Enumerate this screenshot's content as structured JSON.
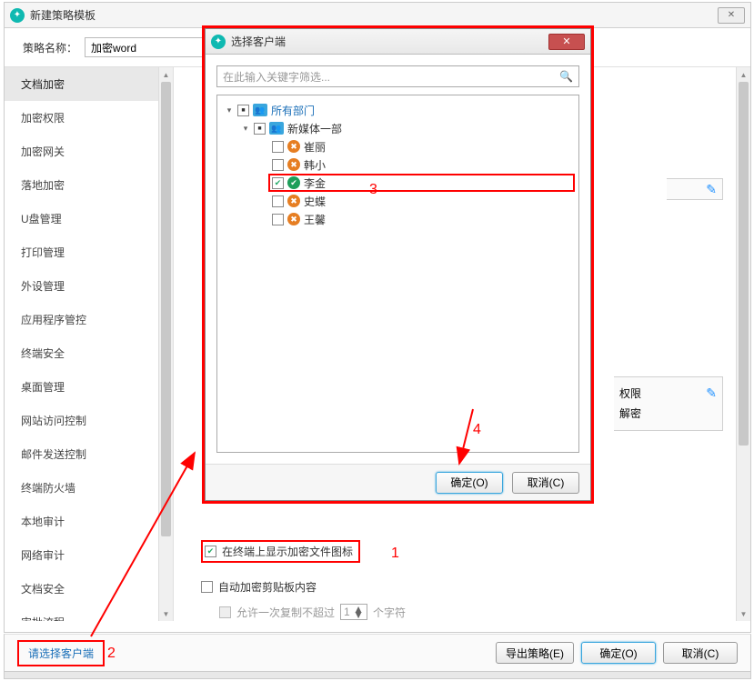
{
  "main": {
    "title": "新建策略模板",
    "name_label": "策略名称：",
    "name_value": "加密word"
  },
  "sidebar": {
    "items": [
      {
        "label": "文档加密",
        "active": true
      },
      {
        "label": "加密权限"
      },
      {
        "label": "加密网关"
      },
      {
        "label": "落地加密"
      },
      {
        "label": "U盘管理"
      },
      {
        "label": "打印管理"
      },
      {
        "label": "外设管理"
      },
      {
        "label": "应用程序管控"
      },
      {
        "label": "终端安全"
      },
      {
        "label": "桌面管理"
      },
      {
        "label": "网站访问控制"
      },
      {
        "label": "邮件发送控制"
      },
      {
        "label": "终端防火墙"
      },
      {
        "label": "本地审计"
      },
      {
        "label": "网络审计"
      },
      {
        "label": "文档安全"
      },
      {
        "label": "审批流程"
      }
    ]
  },
  "content": {
    "fragment_mid_row1": "权限",
    "fragment_mid_row2": "解密",
    "cb_show_icon": "在终端上显示加密文件图标",
    "cb_auto_clip": "自动加密剪贴板内容",
    "cb_allow_copy_prefix": "允许一次复制不超过",
    "cb_allow_copy_value": "1",
    "cb_allow_copy_suffix": "个字符"
  },
  "footer": {
    "select_client": "请选择客户端",
    "export": "导出策略(E)",
    "ok": "确定(O)",
    "cancel": "取消(C)"
  },
  "dialog": {
    "title": "选择客户端",
    "search_placeholder": "在此输入关键字筛选...",
    "root_label": "所有部门",
    "dept1_label": "新媒体一部",
    "users": [
      {
        "label": "崔丽",
        "checked": false,
        "status": "no"
      },
      {
        "label": "韩小",
        "checked": false,
        "status": "no"
      },
      {
        "label": "李金",
        "checked": true,
        "status": "ok",
        "highlight": true
      },
      {
        "label": "史蝶",
        "checked": false,
        "status": "no"
      },
      {
        "label": "王馨",
        "checked": false,
        "status": "no"
      }
    ],
    "ok": "确定(O)",
    "cancel": "取消(C)"
  },
  "annotations": {
    "n1": "1",
    "n2": "2",
    "n3": "3",
    "n4": "4"
  }
}
